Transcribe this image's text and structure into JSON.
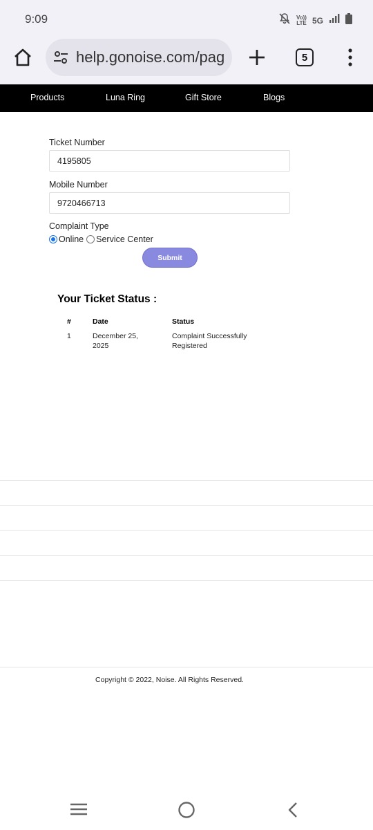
{
  "status_bar": {
    "time": "9:09",
    "network": "5G",
    "volte_top": "Vo))",
    "volte_bottom": "LTE"
  },
  "browser": {
    "url": "help.gonoise.com/pag",
    "tab_count": "5",
    "icons": [
      "home-icon",
      "site-settings-icon",
      "new-tab-plus-icon",
      "tab-switcher-icon",
      "overflow-menu-icon"
    ]
  },
  "nav": {
    "items": [
      "Products",
      "Luna Ring",
      "Gift Store",
      "Blogs"
    ]
  },
  "form": {
    "ticket_label": "Ticket Number",
    "ticket_value": "4195805",
    "mobile_label": "Mobile Number",
    "mobile_value": "9720466713",
    "complaint_label": "Complaint Type",
    "options": [
      "Online",
      "Service Center"
    ],
    "selected_option": "Online",
    "submit_label": "Submit"
  },
  "ticket_status": {
    "title": "Your Ticket Status :",
    "headers": [
      "#",
      "Date",
      "Status"
    ],
    "rows": [
      {
        "num": "1",
        "date_line1": "December 25,",
        "date_line2": "2025",
        "status_line1": "Complaint Successfully",
        "status_line2": "Registered"
      }
    ]
  },
  "footer": {
    "copyright": "Copyright © 2022, Noise. All Rights Reserved."
  },
  "system_nav": {
    "icons": [
      "recent-apps-icon",
      "home-circle-icon",
      "back-icon"
    ]
  },
  "colors": {
    "nav_bg": "#000000",
    "submit_bg": "#8a89e0",
    "radio_accent": "#1a73e8",
    "browser_chrome": "#f3f1f8"
  }
}
